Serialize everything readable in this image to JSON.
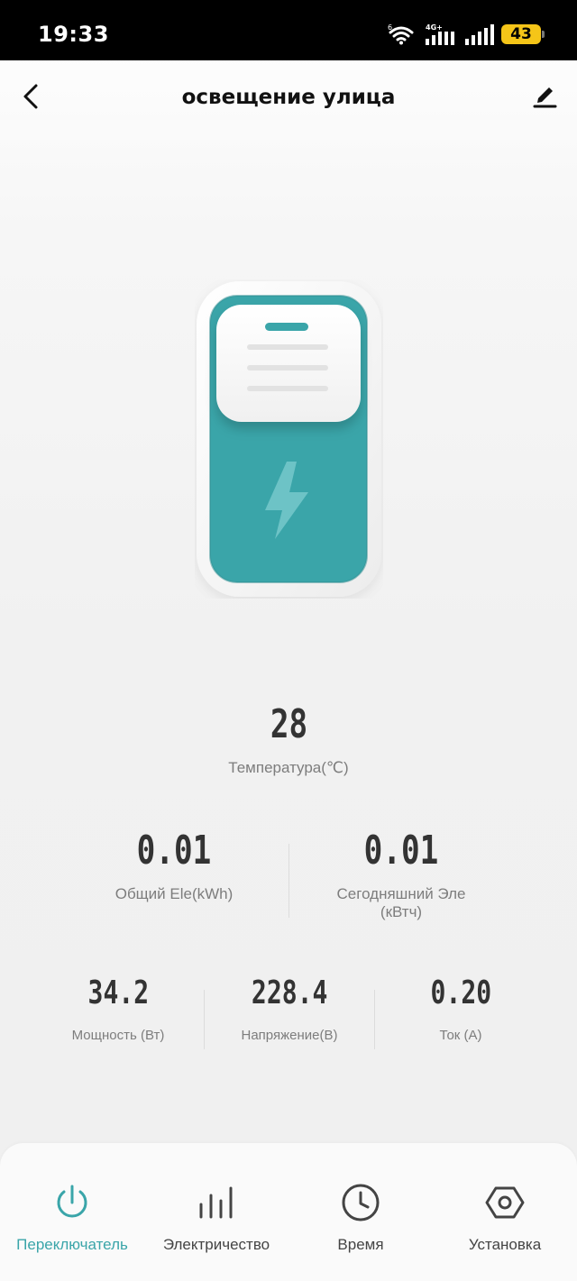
{
  "status_bar": {
    "time": "19:33",
    "network_label": "4G+",
    "battery": "43"
  },
  "header": {
    "title": "освещение улица",
    "back_icon": "chevron-left-icon",
    "edit_icon": "pencil-icon"
  },
  "device": {
    "icon": "lightning-icon",
    "accent_color": "#3aa5a9"
  },
  "readings": {
    "temperature": {
      "value": "28",
      "label": "Температура(℃)"
    },
    "total_energy": {
      "value": "0.01",
      "label": "Общий Ele(kWh)"
    },
    "today_energy": {
      "value": "0.01",
      "label": "Сегодняшний Эле (кВтч)"
    },
    "power": {
      "value": "34.2",
      "label": "Мощность (Вт)"
    },
    "voltage": {
      "value": "228.4",
      "label": "Напряжение(В)"
    },
    "current": {
      "value": "0.20",
      "label": "Ток (А)"
    }
  },
  "bottom_nav": {
    "active_color": "#3aa5a9",
    "items": [
      {
        "label": "Переключатель",
        "icon": "power-icon",
        "active": true
      },
      {
        "label": "Электричество",
        "icon": "bar-chart-icon",
        "active": false
      },
      {
        "label": "Время",
        "icon": "clock-icon",
        "active": false
      },
      {
        "label": "Установка",
        "icon": "settings-hex-icon",
        "active": false
      }
    ]
  }
}
